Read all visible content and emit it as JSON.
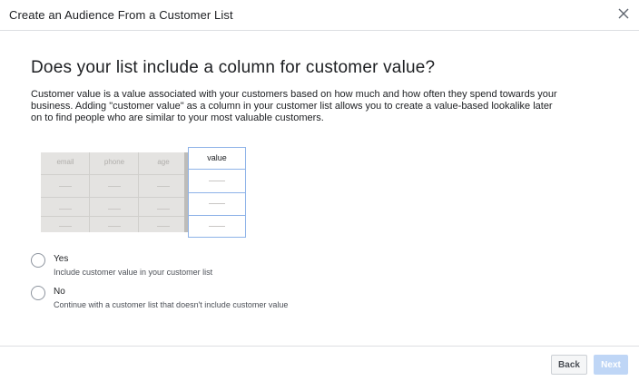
{
  "dialog": {
    "title": "Create an Audience From a Customer List",
    "close_icon": "close-icon"
  },
  "content": {
    "question": "Does your list include a column for customer value?",
    "description": "Customer value is a value associated with your customers based on how much and how often they spend towards your business. Adding \"customer value\" as a column in your customer list allows you to create a value-based lookalike later on to find people who are similar to your most valuable customers."
  },
  "illustration": {
    "columns": [
      "email",
      "phone",
      "age"
    ],
    "value_column": "value"
  },
  "options": [
    {
      "label": "Yes",
      "description": "Include customer value in your customer list"
    },
    {
      "label": "No",
      "description": "Continue with a customer list that doesn't include customer value"
    }
  ],
  "footer": {
    "back_label": "Back",
    "next_label": "Next"
  },
  "colors": {
    "accent_border": "#8eb3e8",
    "next_disabled": "#bfd6f6"
  }
}
